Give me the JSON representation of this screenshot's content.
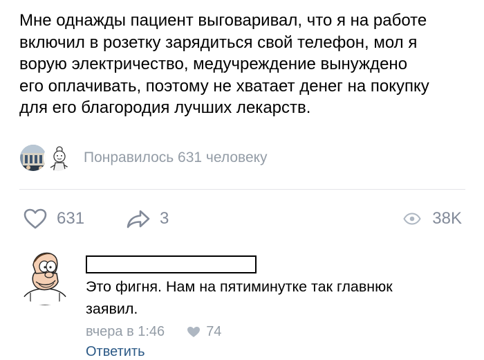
{
  "post": {
    "text_lines": [
      "Мне однажды пациент выговаривал, что я на работе",
      "включил в розетку зарядиться свой телефон, мол я",
      "ворую электричество, медучреждение вынуждено",
      "его оплачивать, поэтому не хватает денег на покупку",
      "для его благородия лучших лекарств."
    ],
    "likers_text": "Понравилось 631 человеку"
  },
  "actions": {
    "likes": "631",
    "shares": "3",
    "views": "38K"
  },
  "comment": {
    "author_name": "",
    "text_lines": [
      "Это фигня. Нам на пятиминутке так главнюк",
      "заявил."
    ],
    "time": "вчера в 1:46",
    "likes": "74",
    "reply_label": "Ответить"
  },
  "colors": {
    "muted": "#939ca6",
    "icon": "#828a99",
    "link": "#2a5885"
  },
  "icons": [
    "heart-outline-icon",
    "share-arrow-icon",
    "eye-icon",
    "heart-filled-icon"
  ]
}
